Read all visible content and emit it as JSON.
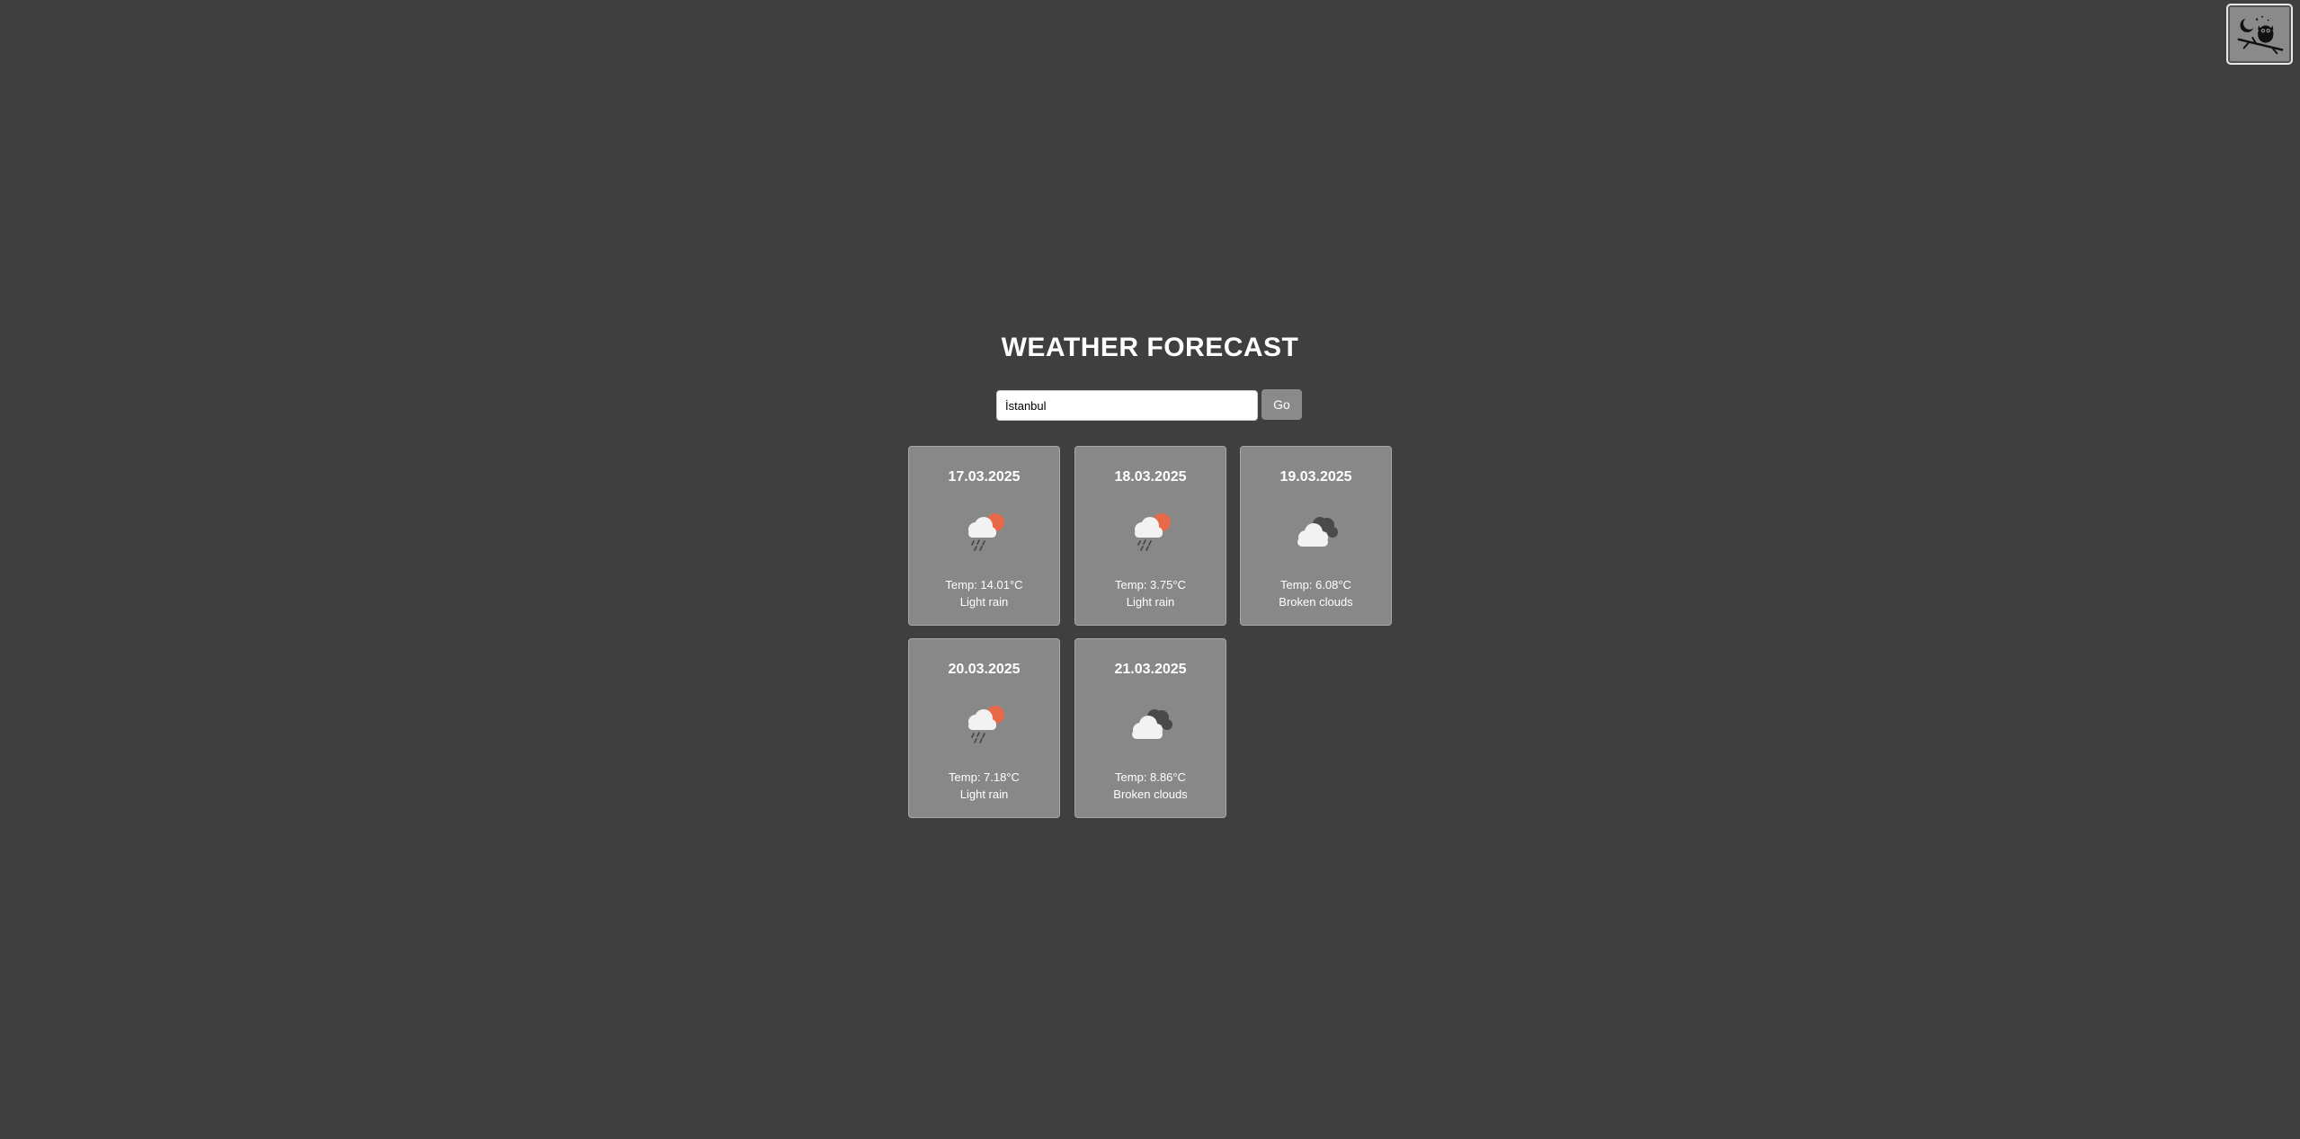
{
  "header": {
    "title": "WEATHER FORECAST",
    "theme_toggle_icon": "owl-moon-icon"
  },
  "search": {
    "value": "İstanbul",
    "button_label": "Go"
  },
  "forecast": [
    {
      "date": "17.03.2025",
      "temp": "Temp: 14.01°C",
      "description": "Light rain",
      "icon": "rain-cloud-sun-icon"
    },
    {
      "date": "18.03.2025",
      "temp": "Temp: 3.75°C",
      "description": "Light rain",
      "icon": "rain-cloud-sun-icon"
    },
    {
      "date": "19.03.2025",
      "temp": "Temp: 6.08°C",
      "description": "Broken clouds",
      "icon": "broken-clouds-icon"
    },
    {
      "date": "20.03.2025",
      "temp": "Temp: 7.18°C",
      "description": "Light rain",
      "icon": "rain-cloud-sun-icon"
    },
    {
      "date": "21.03.2025",
      "temp": "Temp: 8.86°C",
      "description": "Broken clouds",
      "icon": "broken-clouds-icon"
    }
  ],
  "colors": {
    "background": "#3f3f3f",
    "card": "#888888",
    "sun": "#e8694a"
  }
}
